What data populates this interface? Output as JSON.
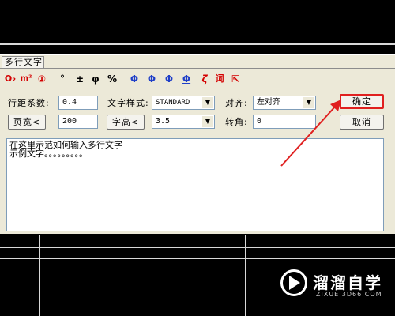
{
  "dialog": {
    "title": "多行文字",
    "toolbar": [
      {
        "icon": "O₂",
        "name": "stack-icon"
      },
      {
        "icon": "m²",
        "name": "superscript-icon"
      },
      {
        "icon": "①",
        "name": "circled-number-icon"
      },
      {
        "icon": "°",
        "name": "degree-icon"
      },
      {
        "icon": "±",
        "name": "plus-minus-icon"
      },
      {
        "icon": "φ",
        "name": "diameter-icon"
      },
      {
        "icon": "%",
        "name": "percent-icon"
      },
      {
        "icon": "Φ",
        "name": "steel-symbol-1-icon"
      },
      {
        "icon": "Φ",
        "name": "steel-symbol-2-icon"
      },
      {
        "icon": "Φ",
        "name": "steel-symbol-3-icon"
      },
      {
        "icon": "Φ",
        "name": "steel-symbol-4-icon"
      },
      {
        "icon": "ζ",
        "name": "special-char-icon"
      },
      {
        "icon": "词",
        "name": "word-library-icon"
      },
      {
        "icon": "⇱",
        "name": "pick-text-icon"
      }
    ],
    "line_spacing_label": "行距系数:",
    "line_spacing_value": "0.4",
    "page_width_button": "页宽<",
    "page_width_value": "200",
    "text_style_label": "文字样式:",
    "text_style_value": "STANDARD",
    "char_height_button": "字高<",
    "char_height_value": "3.5",
    "align_label": "对齐:",
    "align_value": "左对齐",
    "rotate_label": "转角:",
    "rotate_value": "0",
    "ok_button": "确定",
    "cancel_button": "取消",
    "text_lines": [
      "在这里示范如何输入多行文字",
      "示例文字。。。。。。。。。"
    ]
  },
  "watermark": {
    "title": "溜溜自学",
    "url": "ZIXUE.3D66.COM"
  },
  "colors": {
    "highlight": "#e02020",
    "dialog_bg": "#ece9d8",
    "canvas_bg": "#000000"
  }
}
